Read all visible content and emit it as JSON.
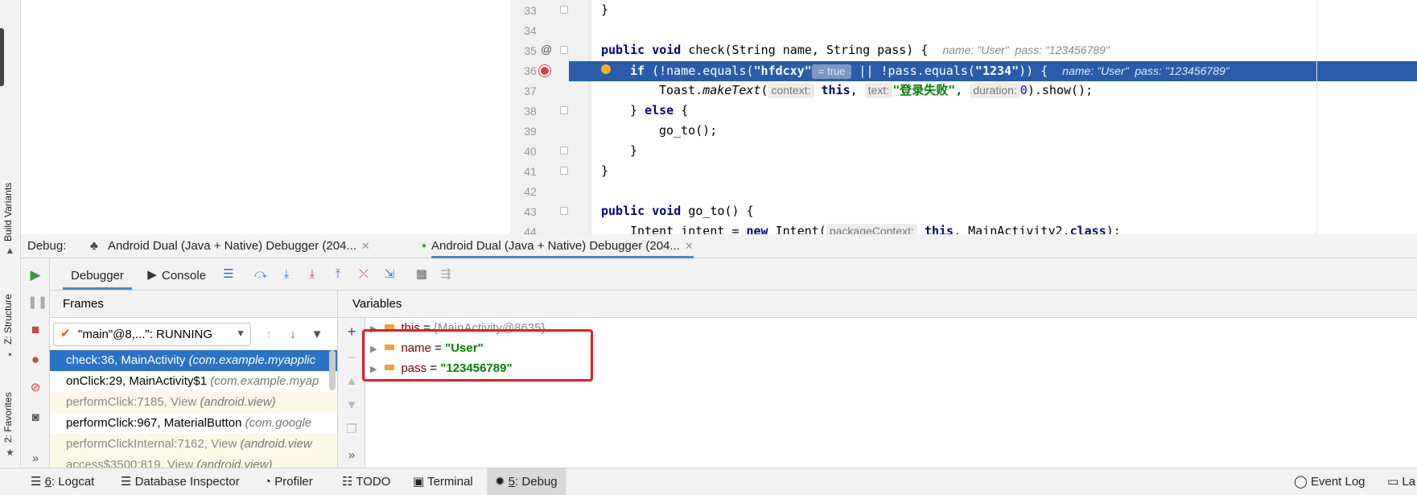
{
  "side_tabs": {
    "build_variants": "Build Variants",
    "structure": "Z: Structure",
    "favorites": "2: Favorites"
  },
  "editor": {
    "line_numbers": [
      "33",
      "34",
      "35",
      "36",
      "37",
      "38",
      "39",
      "40",
      "41",
      "42",
      "43",
      "44"
    ],
    "line33": "}",
    "line35": {
      "kw": "public void",
      "rest": " check(String name, String pass) {",
      "hint": "name: \"User\"  pass: \"123456789\""
    },
    "line36": {
      "kw1": "if",
      "p1": " (!name.equals(",
      "s1": "\"hfdcxy\"",
      "inlay": "= true",
      "p2": " || !pass.equals(",
      "s2": "\"1234\"",
      "p3": ")) {",
      "hint": "name: \"User\"  pass: \"123456789\""
    },
    "line37": {
      "p1": "Toast.",
      "method": "makeText",
      "p2": "(",
      "h1": "context:",
      "kw": "this",
      "p3": ", ",
      "h2": "text:",
      "s": "\"登录失败\"",
      "p4": ", ",
      "h3": "duration:",
      "num": "0",
      "p5": ").show();"
    },
    "line38": {
      "p1": "} ",
      "kw": "else",
      "p2": " {"
    },
    "line39": "go_to();",
    "line40": "}",
    "line41": "}",
    "line43": {
      "kw": "public void",
      "rest": " go_to() {"
    },
    "line44": {
      "p1": "Intent intent = ",
      "kw": "new",
      "p2": " Intent(",
      "h": "packageContext:",
      "kw2": "this",
      "p3": ", MainActivity2.",
      "kw3": "class",
      "p4": ");"
    }
  },
  "debug": {
    "label": "Debug:",
    "tabs": [
      "Android Dual (Java + Native) Debugger (204...",
      "Android Dual (Java + Native) Debugger (204..."
    ],
    "toolbar": {
      "debugger": "Debugger",
      "console": "Console"
    },
    "frames_header": "Frames",
    "variables_header": "Variables",
    "thread_select": "\"main\"@8,...\": RUNNING",
    "frames": [
      {
        "method": "check:36, MainActivity",
        "pkg": "(com.example.myapplic"
      },
      {
        "method": "onClick:29, MainActivity$1",
        "pkg": "(com.example.myap"
      },
      {
        "method": "performClick:7185, View",
        "pkg": "(android.view)"
      },
      {
        "method": "performClick:967, MaterialButton",
        "pkg": "(com.google"
      },
      {
        "method": "performClickInternal:7162, View",
        "pkg": "(android.view"
      },
      {
        "method": "access$3500:819, View",
        "pkg": "(android.view)"
      }
    ],
    "variables": [
      {
        "name": "this",
        "eq": " = ",
        "value": "{MainActivity@8635}"
      },
      {
        "name": "name",
        "eq": " = ",
        "value": "\"User\""
      },
      {
        "name": "pass",
        "eq": " = ",
        "value": "\"123456789\""
      }
    ]
  },
  "bottom_tabs": [
    {
      "key": "6",
      "label": ": Logcat"
    },
    {
      "key": "",
      "label": "Database Inspector"
    },
    {
      "key": "",
      "label": "Profiler"
    },
    {
      "key": "",
      "label": "TODO"
    },
    {
      "key": "",
      "label": "Terminal"
    },
    {
      "key": "5",
      "label": ": Debug"
    }
  ],
  "bottom_right": {
    "event_log": "Event Log",
    "layout": "La"
  },
  "colors": {
    "accent": "#2a72c6",
    "highlight": "#2a5cab",
    "annotation_box": "#e02020"
  }
}
